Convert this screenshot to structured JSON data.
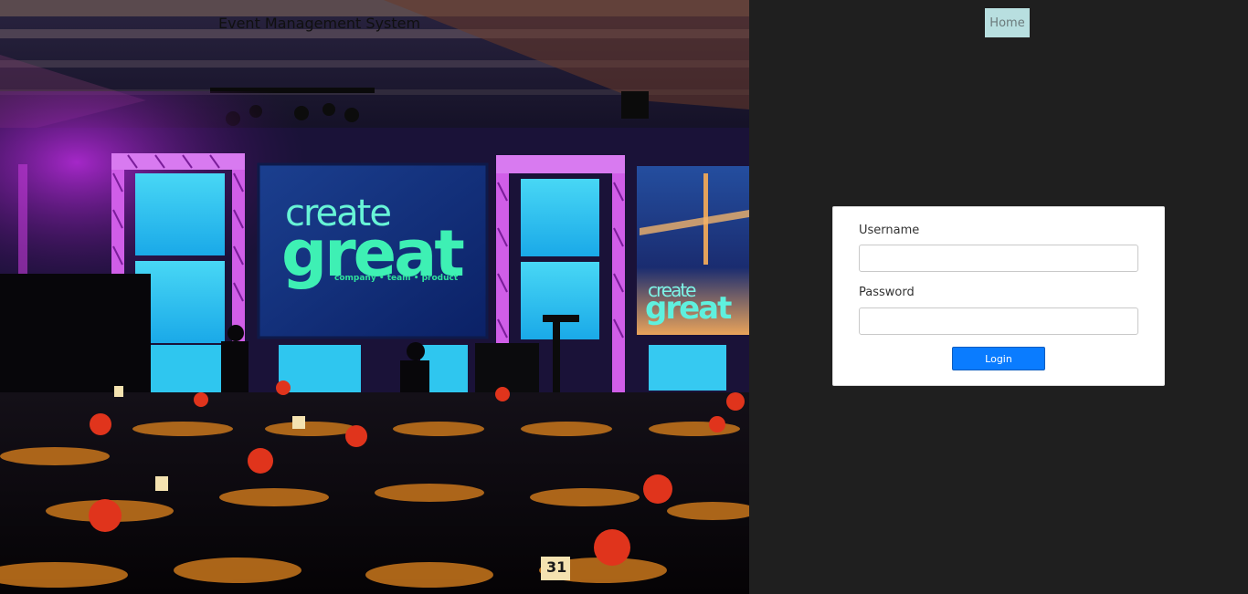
{
  "header": {
    "site_title": "Event Management System"
  },
  "nav": {
    "home_label": "Home"
  },
  "hero": {
    "screen_line1": "create",
    "screen_line2": "great",
    "screen_tagline": "company • team • product",
    "side_line1": "create",
    "side_line2": "great",
    "table_number": "31"
  },
  "login": {
    "username_label": "Username",
    "username_value": "",
    "password_label": "Password",
    "password_value": "",
    "submit_label": "Login"
  },
  "colors": {
    "page_background": "#1f1f1f",
    "nav_home_background": "#b8dfe0",
    "login_button": "#0a7cff",
    "card_background": "#ffffff"
  }
}
